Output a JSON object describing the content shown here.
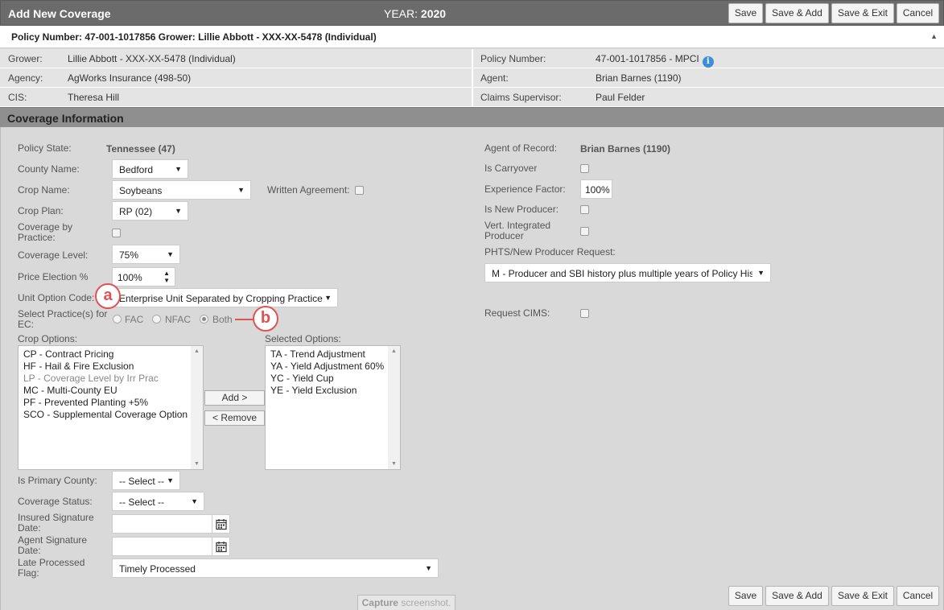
{
  "header": {
    "title": "Add New Coverage",
    "year_label": "YEAR:",
    "year_value": "2020",
    "buttons": {
      "save": "Save",
      "save_add": "Save & Add",
      "save_exit": "Save & Exit",
      "cancel": "Cancel"
    }
  },
  "policy_bar": {
    "text": "Policy Number: 47-001-1017856 Grower: Lillie Abbott - XXX-XX-5478 (Individual)",
    "collapse_icon": "triangle-up-icon"
  },
  "info": {
    "grower_label": "Grower:",
    "grower_value": "Lillie Abbott - XXX-XX-5478 (Individual)",
    "policy_label": "Policy Number:",
    "policy_value": "47-001-1017856 - MPCI",
    "agency_label": "Agency:",
    "agency_value": "AgWorks Insurance (498-50)",
    "agent_label": "Agent:",
    "agent_value": "Brian Barnes (1190)",
    "cis_label": "CIS:",
    "cis_value": "Theresa Hill",
    "claims_label": "Claims Supervisor:",
    "claims_value": "Paul Felder"
  },
  "section_title": "Coverage Information",
  "form_left": {
    "policy_state_label": "Policy State:",
    "policy_state_value": "Tennessee (47)",
    "county_label": "County Name:",
    "county_value": "Bedford",
    "crop_label": "Crop Name:",
    "crop_value": "Soybeans",
    "written_agreement_label": "Written Agreement:",
    "crop_plan_label": "Crop Plan:",
    "crop_plan_value": "RP (02)",
    "coverage_practice_label_1": "Coverage by",
    "coverage_practice_label_2": "Practice:",
    "coverage_level_label": "Coverage Level:",
    "coverage_level_value": "75%",
    "price_election_label": "Price Election %",
    "price_election_value": "100%",
    "unit_option_label": "Unit Option Code:",
    "unit_option_value": "Enterprise Unit Separated by Cropping Practice",
    "select_practice_label_1": "Select Practice(s) for",
    "select_practice_label_2": "EC:",
    "practice_options": [
      "FAC",
      "NFAC",
      "Both"
    ],
    "crop_options_label": "Crop Options:",
    "crop_options": [
      "CP - Contract Pricing",
      "HF - Hail & Fire Exclusion",
      "LP - Coverage Level by Irr Prac",
      "MC - Multi-County EU",
      "PF - Prevented Planting +5%",
      "SCO - Supplemental Coverage Option"
    ],
    "add_button": "Add >",
    "remove_button": "< Remove",
    "selected_options_label": "Selected Options:",
    "selected_options": [
      "TA - Trend Adjustment",
      "YA - Yield Adjustment 60%",
      "YC - Yield Cup",
      "YE - Yield Exclusion"
    ],
    "primary_county_label": "Is Primary County:",
    "primary_county_value": "-- Select --",
    "coverage_status_label": "Coverage Status:",
    "coverage_status_value": "-- Select --",
    "insured_sig_label_1": "Insured Signature",
    "insured_sig_label_2": "Date:",
    "agent_sig_label_1": "Agent Signature",
    "agent_sig_label_2": "Date:",
    "late_flag_label_1": "Late Processed",
    "late_flag_label_2": "Flag:",
    "late_flag_value": "Timely Processed"
  },
  "form_right": {
    "agent_record_label": "Agent of Record:",
    "agent_record_value": "Brian Barnes (1190)",
    "carryover_label": "Is Carryover",
    "experience_label": "Experience Factor:",
    "experience_value": "100%",
    "new_producer_label": "Is New Producer:",
    "vert_label_1": "Vert. Integrated",
    "vert_label_2": "Producer",
    "phts_label": "PHTS/New Producer Request:",
    "phts_value": "M - Producer and SBI history plus multiple years of Policy History",
    "cims_label": "Request CIMS:"
  },
  "markers": {
    "a": "a",
    "b": "b"
  },
  "capture_bold": "Capture",
  "capture_rest": " screenshot."
}
